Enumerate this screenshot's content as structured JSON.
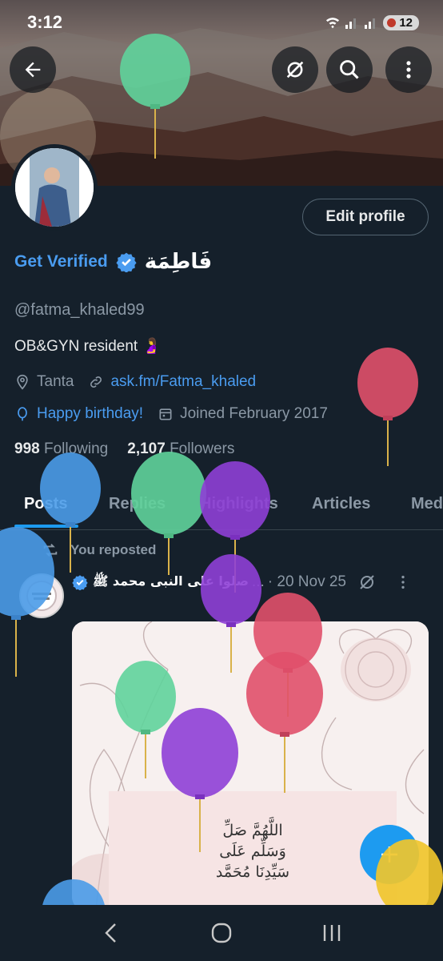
{
  "status": {
    "time": "3:12",
    "battery": "12"
  },
  "header": {
    "back_icon": "arrow-left-icon",
    "actions": [
      "no-signal-icon",
      "search-icon",
      "more-vertical-icon"
    ]
  },
  "profile": {
    "edit_label": "Edit profile",
    "get_verified": "Get Verified",
    "display_name": "فَاطِمَة",
    "handle": "@fatma_khaled99",
    "bio": "OB&GYN resident 🤰",
    "location": "Tanta",
    "website": "ask.fm/Fatma_khaled",
    "birthday": "Happy birthday!",
    "joined": "Joined February 2017",
    "following_count": "998",
    "following_label": "Following",
    "followers_count": "2,107",
    "followers_label": "Followers"
  },
  "tabs": [
    {
      "label": "Posts",
      "active": true
    },
    {
      "label": "Replies"
    },
    {
      "label": "Highlights"
    },
    {
      "label": "Articles"
    },
    {
      "label": "Media"
    }
  ],
  "post": {
    "repost_label": "You reposted",
    "author": "صلوا على النبى محمد ﷺ",
    "dots": "...",
    "date": "· 20 Nov 25",
    "image_text": [
      "اللَّهُمَّ صَلِّ",
      "وَسَلِّم عَلَى",
      "سَيِّدِنَا مُحَمَّد"
    ]
  },
  "colors": {
    "accent": "#1d9bf0",
    "background": "#15202b",
    "verified": "#4a9cf0"
  }
}
